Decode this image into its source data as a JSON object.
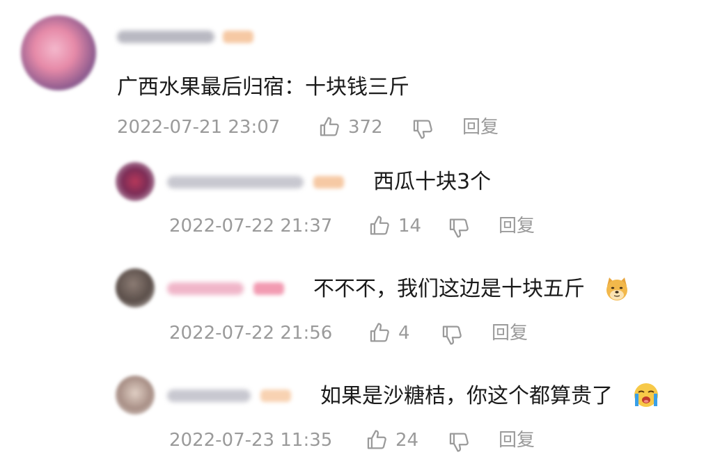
{
  "main_comment": {
    "text": "广西水果最后归宿：十块钱三斤",
    "timestamp": "2022-07-21 23:07",
    "likes": "372",
    "reply_label": "回复"
  },
  "replies": [
    {
      "text": "西瓜十块3个",
      "timestamp": "2022-07-22 21:37",
      "likes": "14",
      "reply_label": "回复"
    },
    {
      "text": "不不不，我们这边是十块五斤",
      "emoji": "doge-emoji",
      "timestamp": "2022-07-22 21:56",
      "likes": "4",
      "reply_label": "回复"
    },
    {
      "text": "如果是沙糖桔，你这个都算贵了",
      "emoji": "crying-emoji",
      "timestamp": "2022-07-23 11:35",
      "likes": "24",
      "reply_label": "回复"
    }
  ],
  "colors": {
    "text": "#1a1a1a",
    "meta": "#9a9a9a",
    "background": "#ffffff"
  }
}
